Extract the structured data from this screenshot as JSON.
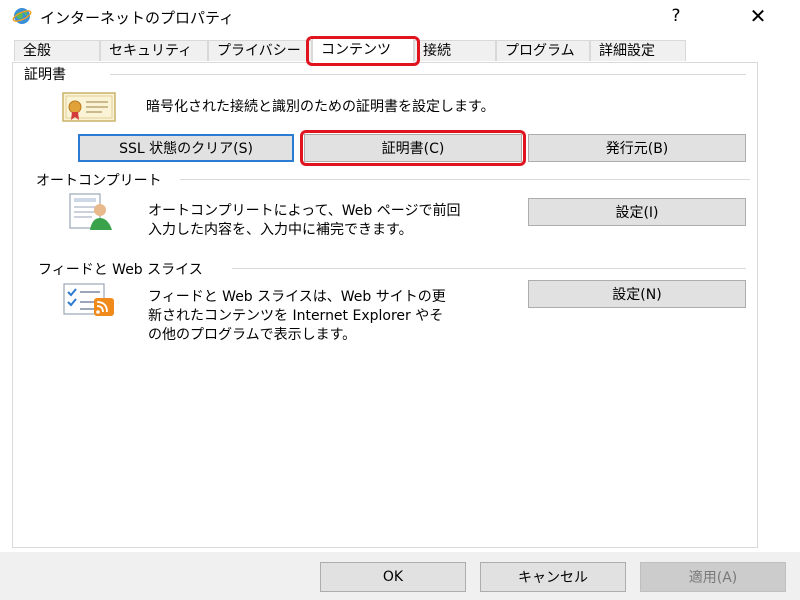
{
  "window": {
    "title": "インターネットのプロパティ",
    "help_label": "?",
    "close_label": "✕"
  },
  "tabs": [
    {
      "label": "全般"
    },
    {
      "label": "セキュリティ"
    },
    {
      "label": "プライバシー"
    },
    {
      "label": "コンテンツ",
      "active": true
    },
    {
      "label": "接続"
    },
    {
      "label": "プログラム"
    },
    {
      "label": "詳細設定"
    }
  ],
  "certificates": {
    "group_label": "証明書",
    "description": "暗号化された接続と識別のための証明書を設定します。",
    "ssl_clear_label": "SSL 状態のクリア(S)",
    "certificates_label": "証明書(C)",
    "publishers_label": "発行元(B)",
    "icon": "certificate-icon"
  },
  "autocomplete": {
    "group_label": "オートコンプリート",
    "description_line1": "オートコンプリートによって、Web ページで前回",
    "description_line2": "入力した内容を、入力中に補完できます。",
    "settings_label": "設定(I)",
    "icon": "autocomplete-icon"
  },
  "feeds": {
    "group_label": "フィードと Web スライス",
    "description_line1": "フィードと Web スライスは、Web サイトの更",
    "description_line2": "新されたコンテンツを Internet Explorer やそ",
    "description_line3": "の他のプログラムで表示します。",
    "settings_label": "設定(N)",
    "icon": "rss-feed-icon"
  },
  "footer": {
    "ok_label": "OK",
    "cancel_label": "キャンセル",
    "apply_label": "適用(A)"
  },
  "colors": {
    "highlight": "#e0141e",
    "focus": "#2b7bd0"
  }
}
